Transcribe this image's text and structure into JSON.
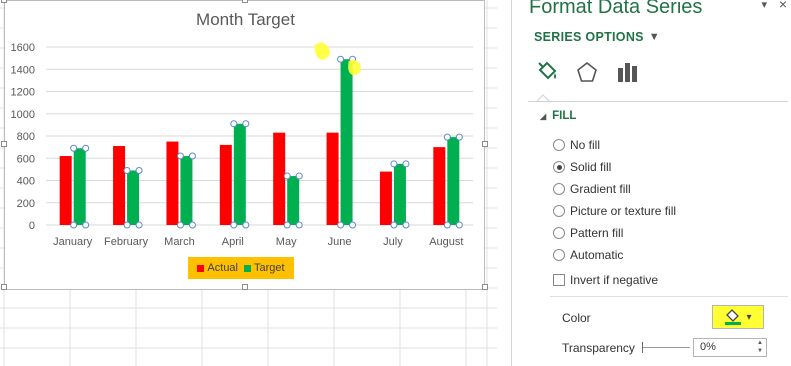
{
  "chart": {
    "title": "Month Target",
    "legend": [
      {
        "label": "Actual",
        "color": "#ff0000"
      },
      {
        "label": "Target",
        "color": "#00b050"
      }
    ]
  },
  "chart_data": {
    "type": "bar",
    "title": "Month Target",
    "categories": [
      "January",
      "February",
      "March",
      "April",
      "May",
      "June",
      "July",
      "August"
    ],
    "series": [
      {
        "name": "Actual",
        "color": "#ff0000",
        "values": [
          620,
          710,
          750,
          720,
          830,
          830,
          480,
          700
        ]
      },
      {
        "name": "Target",
        "color": "#00b050",
        "values": [
          690,
          490,
          620,
          910,
          440,
          1490,
          550,
          790
        ]
      }
    ],
    "y_ticks": [
      "1600",
      "1400",
      "1200",
      "1000",
      "800",
      "600",
      "400",
      "200",
      "0"
    ],
    "ylim": [
      0,
      1600
    ],
    "grid": true,
    "legend_position": "bottom",
    "selected_series": "Target"
  },
  "pane": {
    "title": "Format Data Series",
    "close_glyph": "×",
    "menu_caret": "▾",
    "series_options_label": "SERIES OPTIONS",
    "series_options_caret": "▼",
    "tabs": [
      {
        "name": "fill-line",
        "icon": "paint-bucket-icon"
      },
      {
        "name": "effects",
        "icon": "pentagon-icon"
      },
      {
        "name": "series-options",
        "icon": "bar-chart-icon"
      }
    ],
    "fill_section_label": "FILL",
    "fill_section_toggle": "◢",
    "fill_options": [
      {
        "label": "No fill",
        "selected": false
      },
      {
        "label": "Solid fill",
        "selected": true
      },
      {
        "label": "Gradient fill",
        "selected": false
      },
      {
        "label": "Picture or texture fill",
        "selected": false
      },
      {
        "label": "Pattern fill",
        "selected": false
      },
      {
        "label": "Automatic",
        "selected": false
      }
    ],
    "invert_if_negative_label": "Invert if negative",
    "color_label": "Color",
    "color_value": "#00b050",
    "color_dropdown_glyph": "▾",
    "transparency_label": "Transparency",
    "transparency_value": "0%",
    "spin_up": "▲",
    "spin_down": "▼"
  },
  "highlight_color": "#ffff33"
}
